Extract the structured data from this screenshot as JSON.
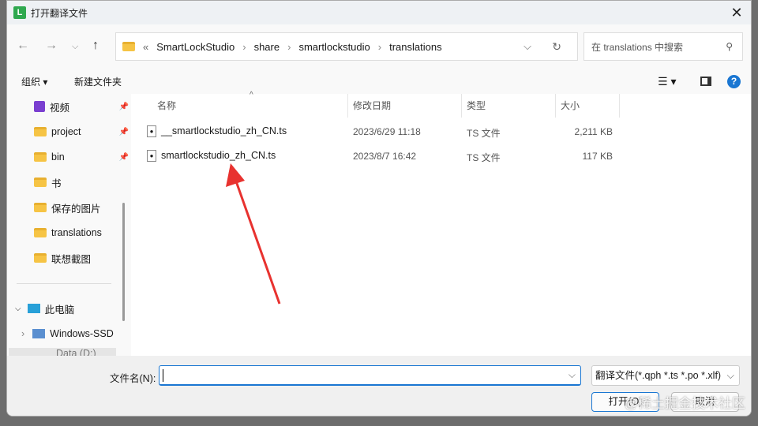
{
  "window": {
    "title": "打开翻译文件"
  },
  "breadcrumb": [
    "SmartLockStudio",
    "share",
    "smartlockstudio",
    "translations"
  ],
  "search": {
    "placeholder": "在 translations 中搜索"
  },
  "toolbar": {
    "organize": "组织",
    "new_folder": "新建文件夹"
  },
  "sidebar": {
    "items": [
      {
        "label": "视频",
        "pinned": true
      },
      {
        "label": "project",
        "pinned": true
      },
      {
        "label": "bin",
        "pinned": true
      },
      {
        "label": "书"
      },
      {
        "label": "保存的图片"
      },
      {
        "label": "translations"
      },
      {
        "label": "联想截图"
      }
    ],
    "this_pc": "此电脑",
    "drive1": "Windows-SSD",
    "drive2": "Data (D:)"
  },
  "columns": {
    "name": "名称",
    "date": "修改日期",
    "type": "类型",
    "size": "大小"
  },
  "files": [
    {
      "name": "__smartlockstudio_zh_CN.ts",
      "date": "2023/6/29 11:18",
      "type": "TS 文件",
      "size": "2,211 KB"
    },
    {
      "name": "smartlockstudio_zh_CN.ts",
      "date": "2023/8/7 16:42",
      "type": "TS 文件",
      "size": "117 KB"
    }
  ],
  "footer": {
    "filename_label": "文件名(N):",
    "filename_value": "",
    "filter": "翻译文件(*.qph *.ts *.po *.xlf)",
    "open": "打开(O)",
    "cancel": "取消"
  },
  "watermark": "@稀土掘金技术社区",
  "colors": {
    "accent": "#1976d2",
    "arrow": "#e8322f"
  }
}
